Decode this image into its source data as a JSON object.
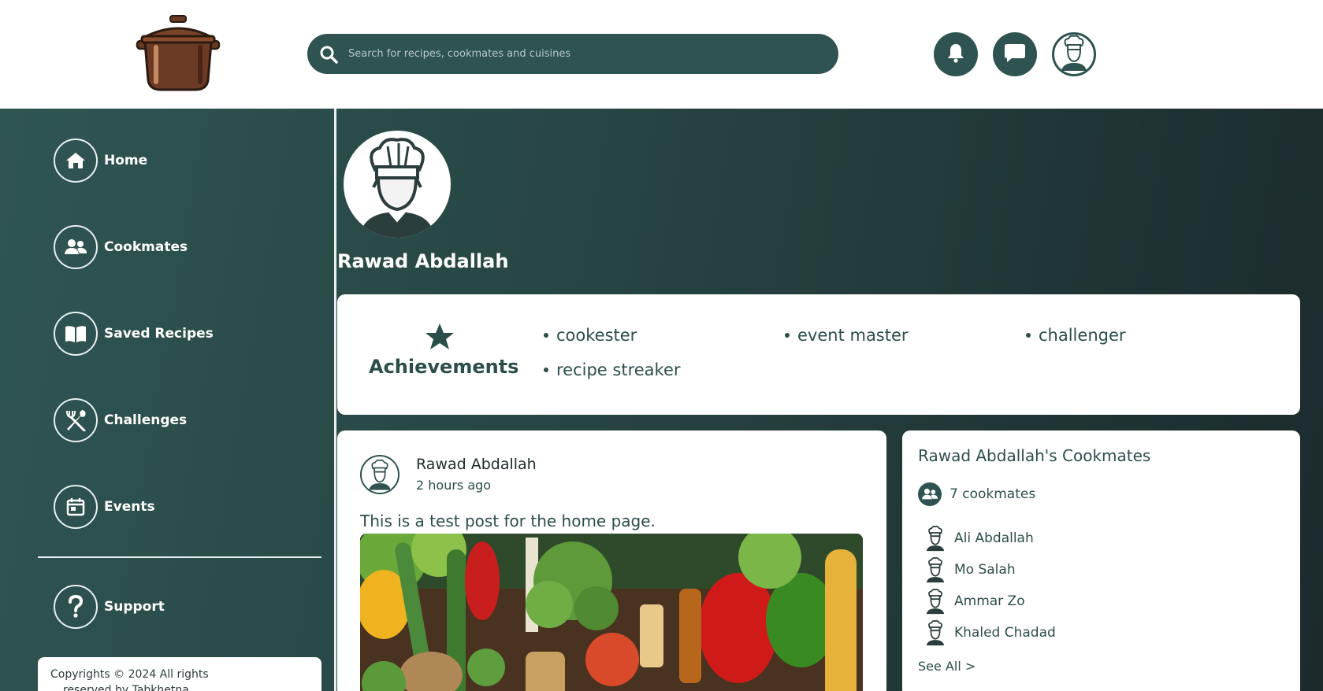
{
  "header": {
    "search_placeholder": "Search for recipes, cookmates and cuisines"
  },
  "sidebar": {
    "items": [
      {
        "label": "Home"
      },
      {
        "label": "Cookmates"
      },
      {
        "label": "Saved Recipes"
      },
      {
        "label": "Challenges"
      },
      {
        "label": "Events"
      }
    ],
    "support_label": "Support",
    "copyright_line1": "Copyrights © 2024 All rights",
    "copyright_line2": "reserved by Tabkhetna"
  },
  "profile": {
    "name": "Rawad Abdallah"
  },
  "achievements": {
    "title": "Achievements",
    "items": [
      "cookester",
      "event master",
      "challenger",
      "recipe streaker"
    ]
  },
  "post": {
    "author": "Rawad Abdallah",
    "time": "2 hours ago",
    "text": "This is a test post for the home page."
  },
  "cookmates": {
    "title": "Rawad Abdallah's Cookmates",
    "count_label": "7 cookmates",
    "list": [
      "Ali Abdallah",
      "Mo Salah",
      "Ammar Zo",
      "Khaled Chadad"
    ],
    "see_all": "See All >"
  },
  "colors": {
    "primary": "#2e5350",
    "text_dark": "#2b4e4b",
    "pot_brown": "#6b3a24"
  }
}
